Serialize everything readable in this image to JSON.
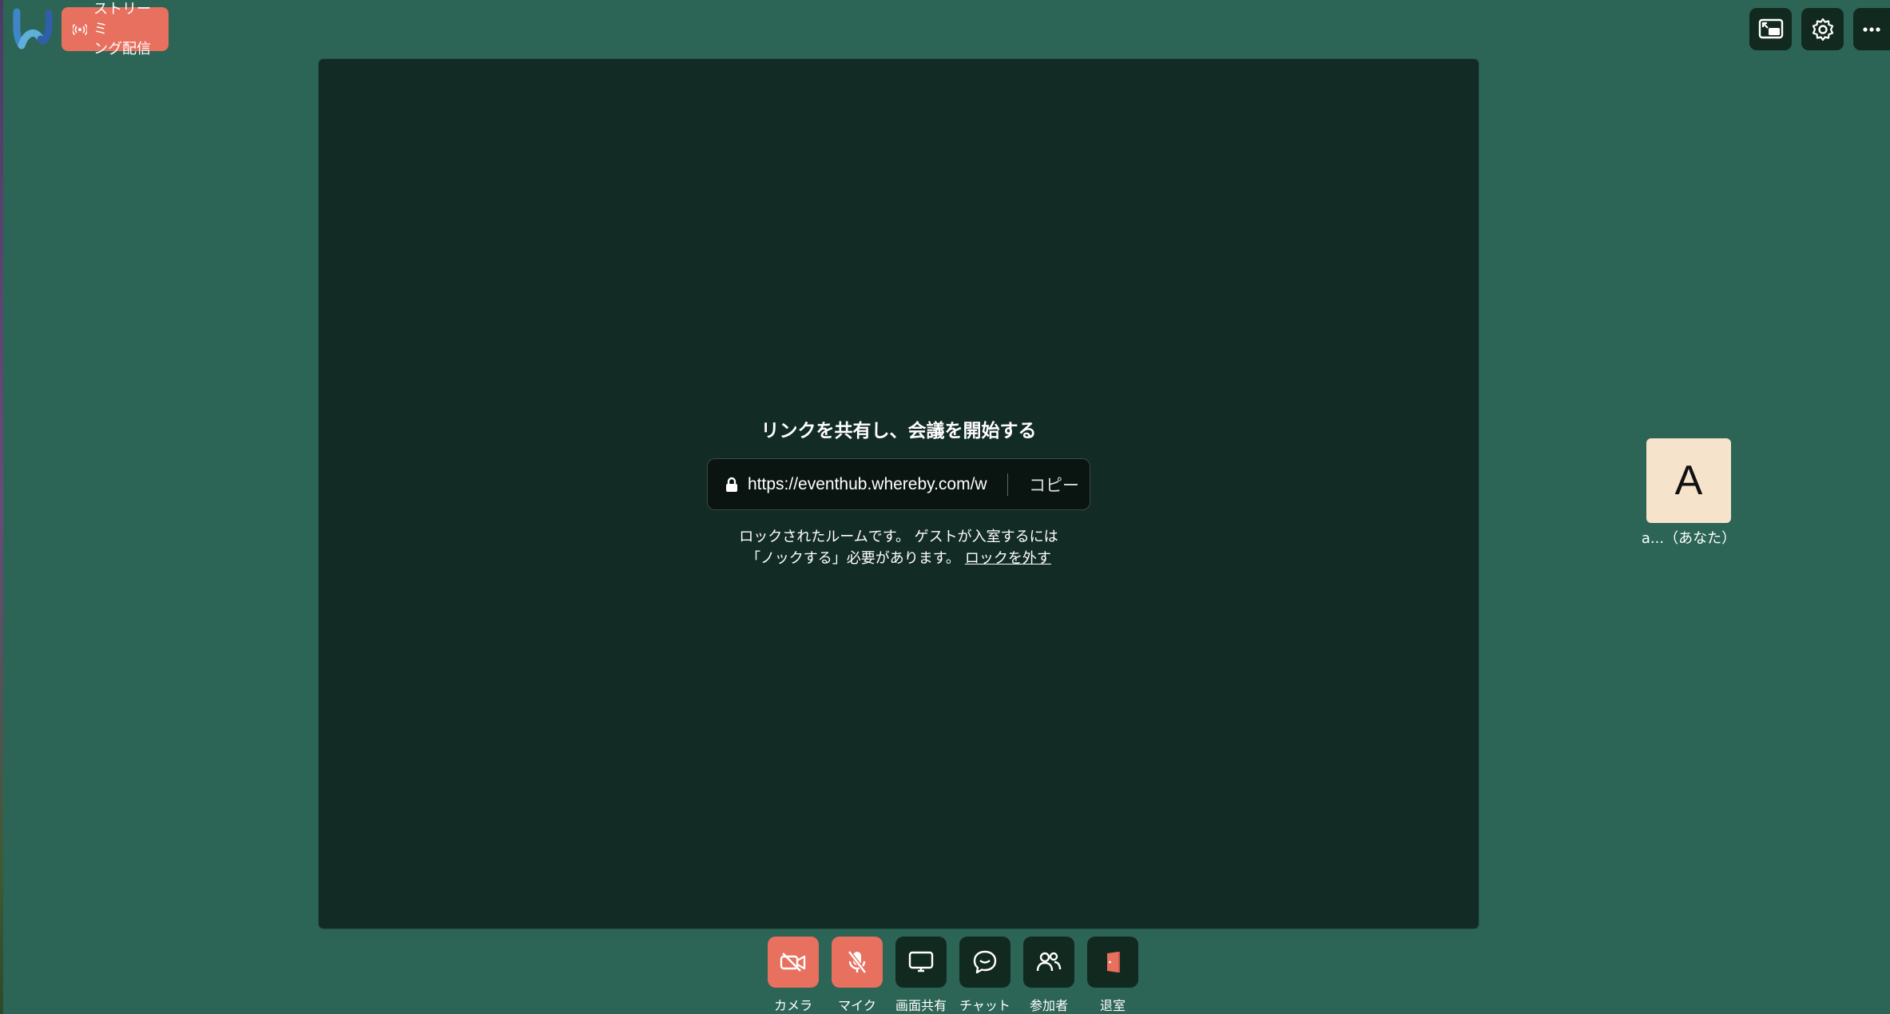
{
  "header": {
    "logo_icon": "whereby-logo-icon",
    "stream_button": {
      "label": "ストリーミ\nング配信",
      "icon": "broadcast-icon"
    },
    "right_buttons": [
      {
        "icon": "picture-in-picture-icon"
      },
      {
        "icon": "gear-icon"
      },
      {
        "icon": "more-horizontal-icon"
      }
    ]
  },
  "share": {
    "title": "リンクを共有し、会議を開始する",
    "url": "https://eventhub.whereby.com/w",
    "copy_label": "コピー",
    "note_line1": "ロックされたルームです。 ゲストが入室するには",
    "note_line2": "「ノックする」必要があります。",
    "unlock_label": "ロックを外す"
  },
  "self": {
    "initial": "A",
    "name": "a...（あなた）"
  },
  "toolbar": {
    "camera": "カメラ",
    "mic": "マイク",
    "screenshare": "画面共有",
    "chat": "チャット",
    "participants": "参加者",
    "leave": "退室"
  },
  "colors": {
    "background": "#2c6555",
    "stage": "#132b25",
    "accent": "#e8705e",
    "button_dark": "#12291f",
    "avatar_bg": "#f6e3cb"
  }
}
